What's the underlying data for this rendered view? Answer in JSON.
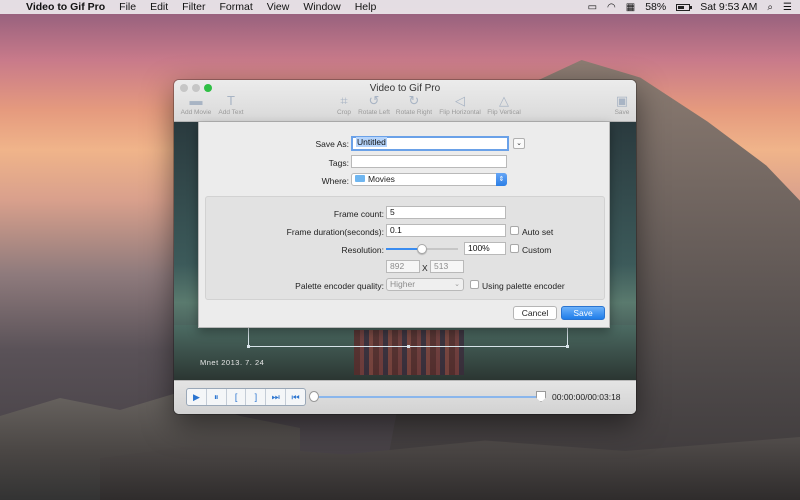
{
  "menubar": {
    "apple": "",
    "app_name": "Video to Gif Pro",
    "menus": [
      "File",
      "Edit",
      "Filter",
      "Format",
      "View",
      "Window",
      "Help"
    ],
    "battery_percent": "58%",
    "clock": "Sat 9:53 AM"
  },
  "window": {
    "title": "Video to Gif Pro",
    "toolbar": {
      "add_movie": "Add Movie",
      "add_text": "Add Text",
      "crop": "Crop",
      "rotate_left": "Rotate Left",
      "rotate_right": "Rotate Right",
      "flip_horizontal": "Flip Horizontal",
      "flip_vertical": "Flip Vertical",
      "save": "Save"
    }
  },
  "video": {
    "stamp": "Mnet 2013. 7. 24"
  },
  "save_sheet": {
    "save_as_label": "Save As:",
    "save_as_value": "Untitled",
    "tags_label": "Tags:",
    "tags_value": "",
    "where_label": "Where:",
    "where_value": "Movies",
    "frame_count_label": "Frame count:",
    "frame_count_value": "5",
    "frame_duration_label": "Frame duration(seconds):",
    "frame_duration_value": "0.1",
    "auto_set_label": "Auto set",
    "resolution_label": "Resolution:",
    "resolution_percent": "100%",
    "resolution_slider_fraction": 0.5,
    "custom_label": "Custom",
    "width_value": "892",
    "x_label": "X",
    "height_value": "513",
    "palette_label": "Palette encoder quality:",
    "palette_value": "Higher",
    "using_palette_label": "Using palette encoder",
    "cancel_label": "Cancel",
    "save_label": "Save"
  },
  "controls": {
    "play": "▶",
    "pause": "⏸",
    "mark_in": "[",
    "mark_out": "]",
    "next": "⏭",
    "prev": "⏮",
    "time": "00:00:00/00:03:18"
  }
}
